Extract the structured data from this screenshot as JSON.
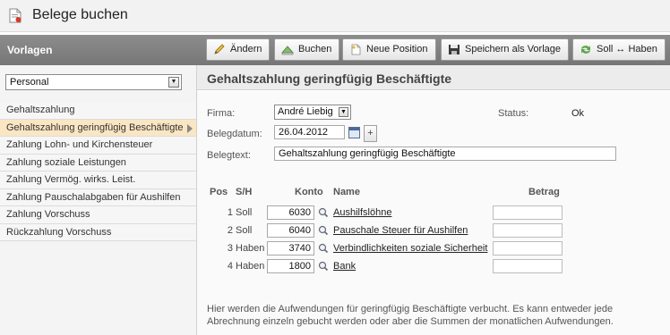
{
  "app": {
    "title": "Belege buchen"
  },
  "sidebar": {
    "header": "Vorlagen",
    "select_value": "Personal",
    "items": [
      {
        "label": "Gehaltszahlung"
      },
      {
        "label": "Gehaltszahlung geringfügig Beschäftigte"
      },
      {
        "label": "Zahlung Lohn- und Kirchensteuer"
      },
      {
        "label": "Zahlung soziale Leistungen"
      },
      {
        "label": "Zahlung Vermög. wirks. Leist."
      },
      {
        "label": "Zahlung Pauschalabgaben für Aushilfen"
      },
      {
        "label": "Zahlung Vorschuss"
      },
      {
        "label": "Rückzahlung Vorschuss"
      }
    ]
  },
  "toolbar": {
    "edit": "Ändern",
    "book": "Buchen",
    "new_position": "Neue Position",
    "save_template": "Speichern als Vorlage",
    "swap": "Soll ↔ Haben"
  },
  "form": {
    "title": "Gehaltszahlung geringfügig Beschäftigte",
    "firma_label": "Firma:",
    "firma_value": "André Liebig",
    "status_label": "Status:",
    "status_value": "Ok",
    "datum_label": "Belegdatum:",
    "datum_value": "26.04.2012",
    "plus": "+",
    "text_label": "Belegtext:",
    "text_value": "Gehaltszahlung geringfügig Beschäftigte"
  },
  "table": {
    "headers": {
      "pos": "Pos",
      "sh": "S/H",
      "konto": "Konto",
      "name": "Name",
      "betrag": "Betrag"
    },
    "rows": [
      {
        "pos": "1",
        "sh": "Soll",
        "konto": "6030",
        "name": "Aushilfslöhne"
      },
      {
        "pos": "2",
        "sh": "Soll",
        "konto": "6040",
        "name": "Pauschale Steuer für Aushilfen"
      },
      {
        "pos": "3",
        "sh": "Haben",
        "konto": "3740",
        "name": "Verbindlichkeiten soziale Sicherheit"
      },
      {
        "pos": "4",
        "sh": "Haben",
        "konto": "1800",
        "name": "Bank"
      }
    ]
  },
  "note": "Hier werden die Aufwendungen für geringfügig Beschäftigte verbucht. Es kann entweder jede Abrechnung einzeln gebucht werden oder aber die Summen der monatlichen Aufwendungen."
}
